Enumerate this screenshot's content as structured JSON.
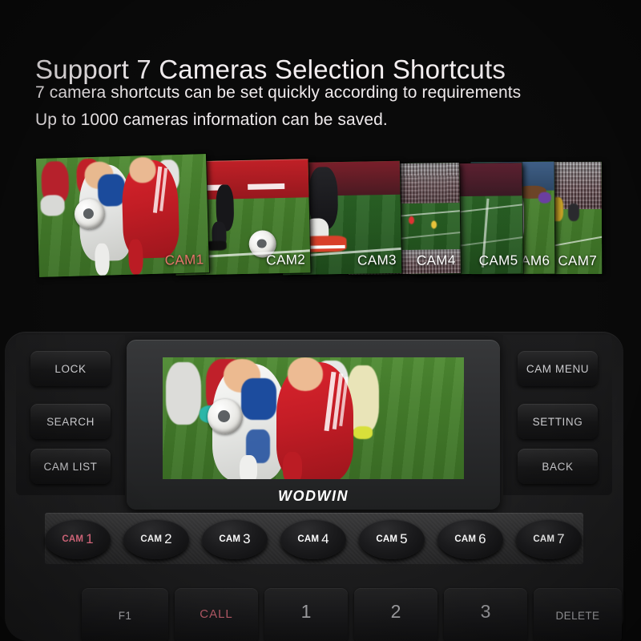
{
  "header": {
    "title": "Support 7 Cameras Selection Shortcuts",
    "subtitle_line1": "7 camera shortcuts can be set quickly according to requirements",
    "subtitle_line2": "Up to 1000 cameras information can be saved."
  },
  "thumbnails": {
    "items": [
      {
        "label": "CAM1",
        "active": true
      },
      {
        "label": "CAM2",
        "active": false
      },
      {
        "label": "CAM3",
        "active": false
      },
      {
        "label": "CAM4",
        "active": false
      },
      {
        "label": "CAM5",
        "active": false
      },
      {
        "label": "CAM6",
        "active": false
      },
      {
        "label": "CAM7",
        "active": false
      }
    ]
  },
  "device": {
    "brand": "WODWIN",
    "left_buttons": [
      {
        "label": "LOCK"
      },
      {
        "label": "SEARCH"
      },
      {
        "label": "CAM LIST"
      }
    ],
    "right_buttons": [
      {
        "label": "CAM MENU"
      },
      {
        "label": "SETTING"
      },
      {
        "label": "BACK"
      }
    ],
    "cam_buttons": [
      {
        "word": "CAM",
        "number": "1",
        "active": true
      },
      {
        "word": "CAM",
        "number": "2",
        "active": false
      },
      {
        "word": "CAM",
        "number": "3",
        "active": false
      },
      {
        "word": "CAM",
        "number": "4",
        "active": false
      },
      {
        "word": "CAM",
        "number": "5",
        "active": false
      },
      {
        "word": "CAM",
        "number": "6",
        "active": false
      },
      {
        "word": "CAM",
        "number": "7",
        "active": false
      }
    ],
    "bottom_keys": [
      {
        "label": "F1",
        "style": "small"
      },
      {
        "label": "CALL",
        "style": "red"
      },
      {
        "label": "1",
        "style": "num"
      },
      {
        "label": "2",
        "style": "num"
      },
      {
        "label": "3",
        "style": "num"
      },
      {
        "label": "DELETE",
        "style": "small"
      }
    ]
  },
  "colors": {
    "background": "#0a0a0a",
    "text_primary": "#f3eef0",
    "active_accent": "#e8766c",
    "cam_active": "#f2758c",
    "call_red": "#c4616f"
  }
}
